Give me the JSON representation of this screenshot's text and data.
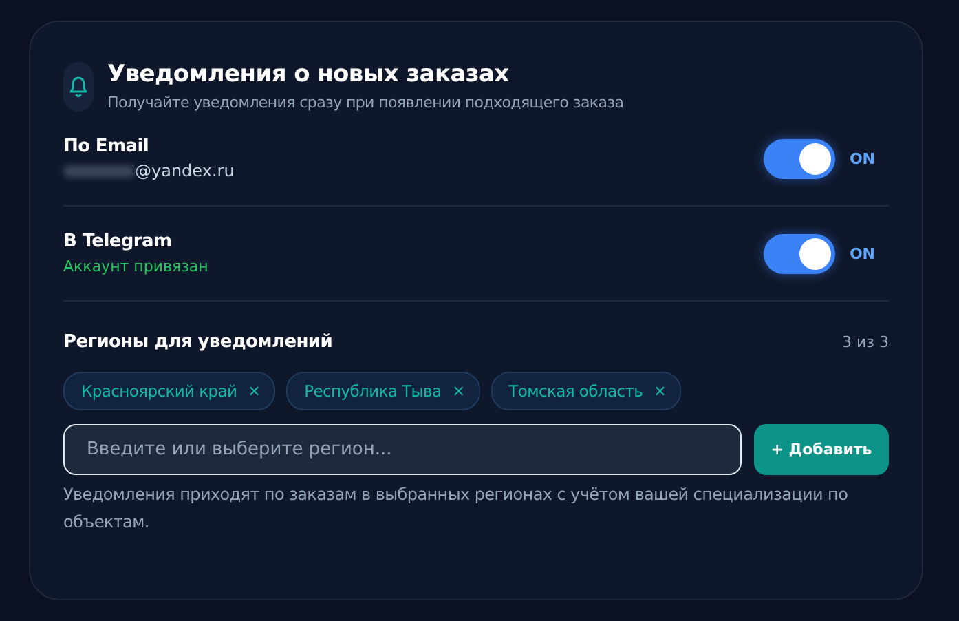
{
  "header": {
    "title": "Уведомления о новых заказах",
    "subtitle": "Получайте уведомления сразу при появлении подходящего заказа"
  },
  "channels": [
    {
      "name": "По Email",
      "detail": "@yandex.ru",
      "kind": "email",
      "on": true,
      "state_label": "ON"
    },
    {
      "name": "В Telegram",
      "detail": "Аккаунт привязан",
      "kind": "status",
      "on": true,
      "state_label": "ON"
    }
  ],
  "regions": {
    "title": "Регионы для уведомлений",
    "count": "3 из 3",
    "tags": [
      {
        "label": "Красноярский край",
        "remove": "✕"
      },
      {
        "label": "Республика Тыва",
        "remove": "✕"
      },
      {
        "label": "Томская область",
        "remove": "✕"
      }
    ],
    "input": {
      "placeholder": "Введите или выберите регион..."
    },
    "add_button": "+ Добавить",
    "note": "Уведомления приходят по заказам в выбранных регионах с учётом вашей специализации по объектам."
  }
}
